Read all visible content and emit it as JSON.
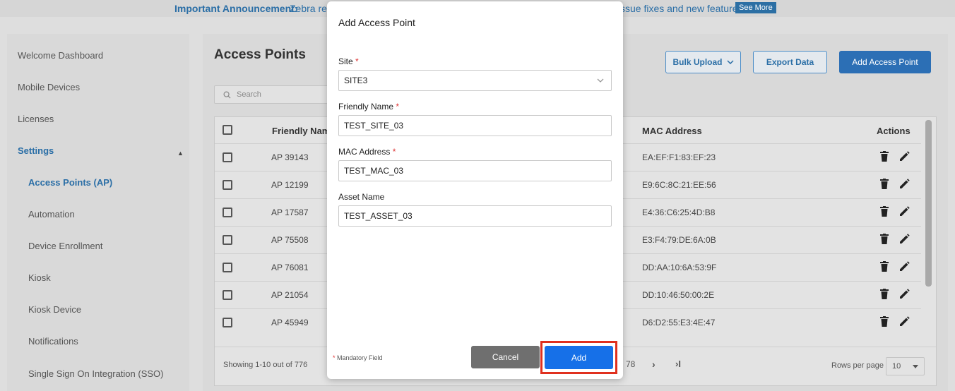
{
  "announcement": {
    "label": "Important Announcement:",
    "text_before": "Zebra re",
    "text_after": "ssue fixes and new features.",
    "see_more": "See More"
  },
  "sidebar": {
    "items": [
      {
        "label": "Welcome Dashboard"
      },
      {
        "label": "Mobile Devices"
      },
      {
        "label": "Licenses"
      },
      {
        "label": "Settings"
      },
      {
        "label": "Access Points (AP)"
      },
      {
        "label": "Automation"
      },
      {
        "label": "Device Enrollment"
      },
      {
        "label": "Kiosk"
      },
      {
        "label": "Kiosk Device"
      },
      {
        "label": "Notifications"
      },
      {
        "label": "Single Sign On Integration (SSO)"
      }
    ],
    "settings_caret": "▲"
  },
  "main": {
    "title": "Access Points",
    "bulk_upload": "Bulk Upload",
    "export_data": "Export Data",
    "add_access_point": "Add Access Point",
    "search_placeholder": "Search"
  },
  "table": {
    "headers": {
      "friendly_name": "Friendly Nam",
      "mac": "MAC Address",
      "actions": "Actions"
    },
    "rows": [
      {
        "name": "AP 39143",
        "mac": "EA:EF:F1:83:EF:23"
      },
      {
        "name": "AP 12199",
        "mac": "E9:6C:8C:21:EE:56"
      },
      {
        "name": "AP 17587",
        "mac": "E4:36:C6:25:4D:B8"
      },
      {
        "name": "AP 75508",
        "mac": "E3:F4:79:DE:6A:0B"
      },
      {
        "name": "AP 76081",
        "mac": "DD:AA:10:6A:53:9F"
      },
      {
        "name": "AP 21054",
        "mac": "DD:10:46:50:00:2E"
      },
      {
        "name": "AP 45949",
        "mac": "D6:D2:55:E3:4E:47"
      }
    ],
    "footer": {
      "showing": "Showing 1-10 out of 776",
      "page_total": "78",
      "next": "›",
      "last": "›I",
      "rows_per_page_label": "Rows per page",
      "rows_per_page_value": "10"
    }
  },
  "modal": {
    "title": "Add Access Point",
    "site_label": "Site",
    "site_value": "SITE3",
    "friendly_label": "Friendly Name",
    "friendly_value": "TEST_SITE_03",
    "mac_label": "MAC Address",
    "mac_value": "TEST_MAC_03",
    "asset_label": "Asset Name",
    "asset_value": "TEST_ASSET_03",
    "required_mark": "*",
    "mandatory_note": "Mandatory Field",
    "cancel": "Cancel",
    "add": "Add"
  },
  "colors": {
    "accent": "#2a6ea6",
    "primary_button": "#1670e8",
    "highlight": "#e0301e"
  }
}
